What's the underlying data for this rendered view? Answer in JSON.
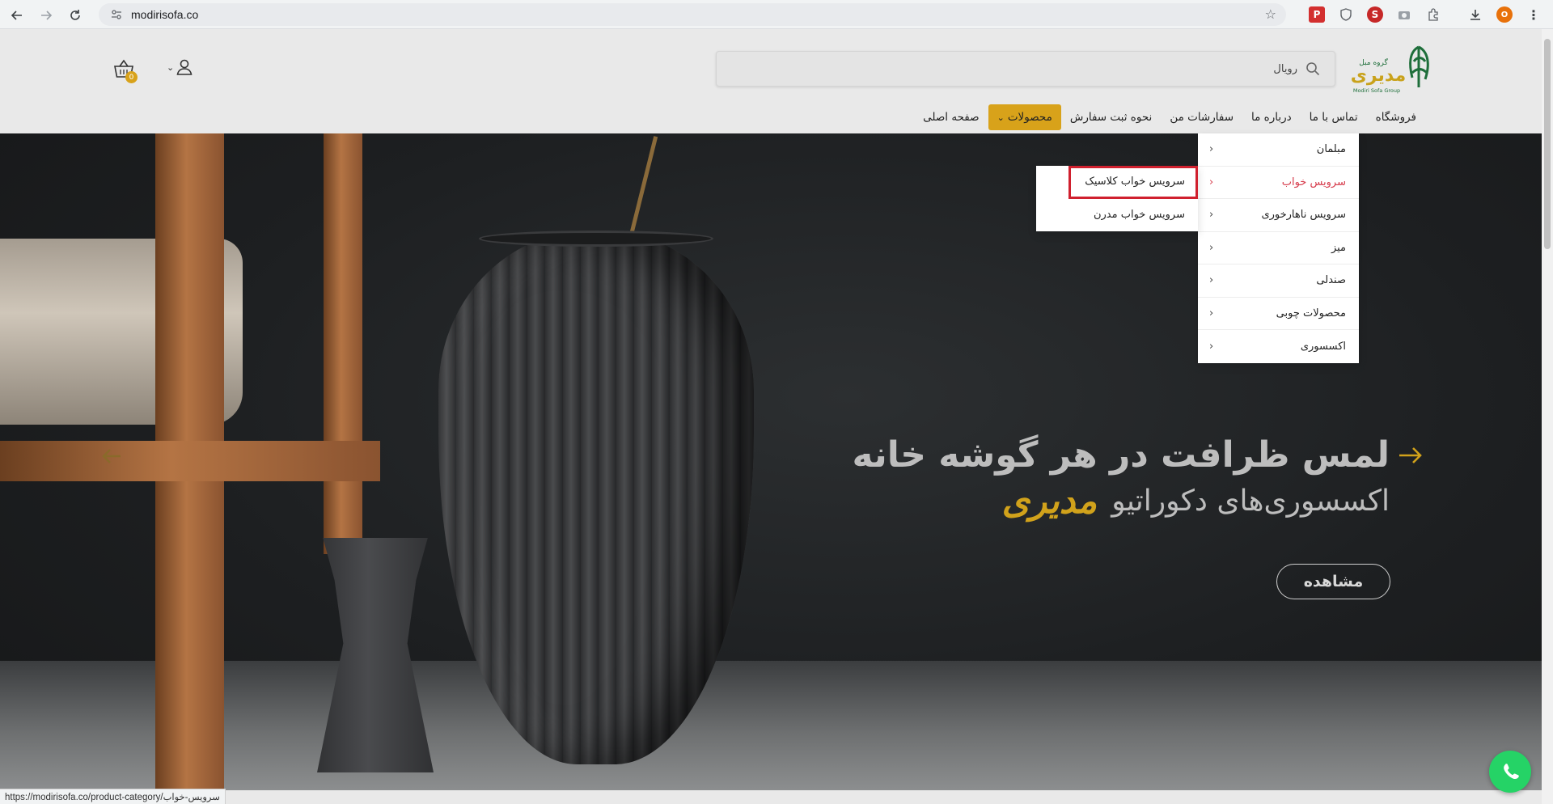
{
  "browser": {
    "url": "modirisofa.co",
    "status_url": "https://modirisofa.co/product-category/سرویس-خواب",
    "profile_initial": "O"
  },
  "logo": {
    "brand_fa_top": "گروه مبل",
    "brand_fa_main": "مدیری",
    "brand_en": "Modiri Sofa Group"
  },
  "search": {
    "value": "رویال"
  },
  "cart": {
    "count": "0"
  },
  "nav": {
    "items": [
      "صفحه اصلی",
      "محصولات",
      "نحوه ثبت سفارش",
      "سفارشات من",
      "درباره ما",
      "تماس با ما",
      "فروشگاه"
    ]
  },
  "dropdown": {
    "items": [
      "مبلمان",
      "سرویس خواب",
      "سرویس ناهارخوری",
      "میز",
      "صندلی",
      "محصولات چوبی",
      "اکسسوری"
    ]
  },
  "submenu": {
    "items": [
      "سرویس خواب کلاسیک",
      "سرویس خواب مدرن"
    ]
  },
  "hero": {
    "line1": "لمس ظرافت در هر گوشه خانه",
    "line2": "اکسسوری‌های دکوراتیو",
    "brand": "مدیری",
    "cta": "مشاهده"
  },
  "colors": {
    "accent": "#d8a21a",
    "hover_text": "#d63a4a",
    "highlight_border": "#d0202e",
    "whatsapp": "#25d366"
  }
}
